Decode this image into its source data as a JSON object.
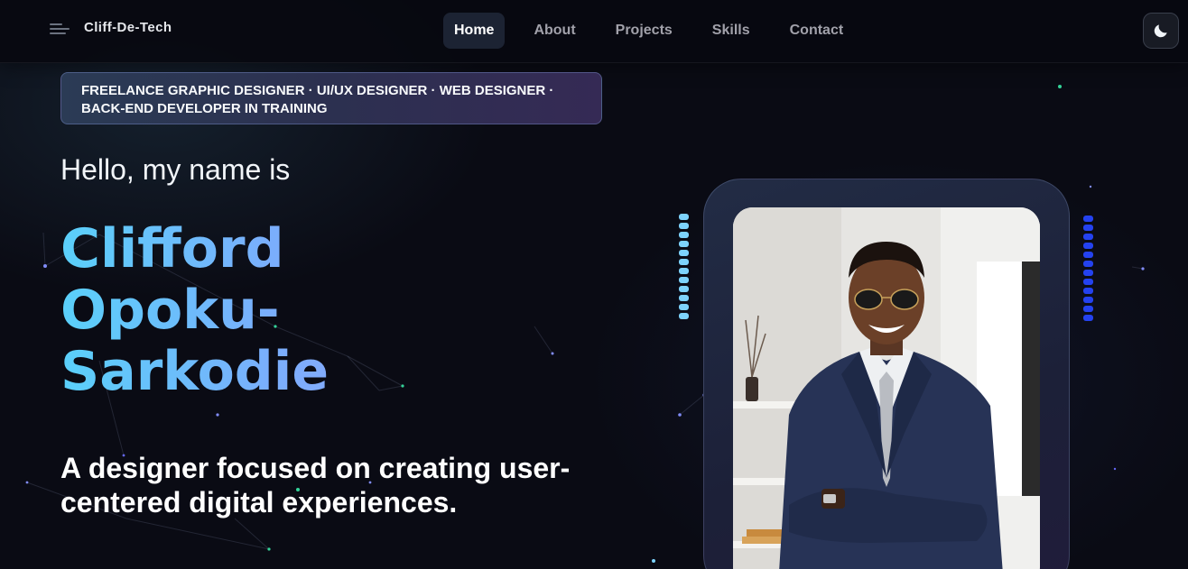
{
  "brand": {
    "name": "Cliff-De-Tech",
    "logo_icon": "brand-logo-icon"
  },
  "nav": {
    "links": [
      {
        "label": "Home",
        "active": true
      },
      {
        "label": "About",
        "active": false
      },
      {
        "label": "Projects",
        "active": false
      },
      {
        "label": "Skills",
        "active": false
      },
      {
        "label": "Contact",
        "active": false
      }
    ],
    "theme_toggle_icon": "moon-icon"
  },
  "hero": {
    "tagline_line1": "FREELANCE GRAPHIC DESIGNER · UI/UX DESIGNER · WEB DESIGNER ·",
    "tagline_line2": "BACK-END DEVELOPER IN TRAINING",
    "greeting": "Hello, my name is",
    "name_lines": [
      "Clifford",
      "Opoku-",
      "Sarkodie"
    ],
    "subtitle": "A designer focused on creating user-centered digital experiences."
  },
  "portrait": {
    "subject": "portrait-photo"
  },
  "colors": {
    "background": "#0a0b14",
    "accent_cyan": "#5ad0fa",
    "accent_violet": "#9da0f8",
    "stripe_left": "#7dd3fc",
    "stripe_right": "#2442f0",
    "nav_active_bg": "#1c2333"
  }
}
